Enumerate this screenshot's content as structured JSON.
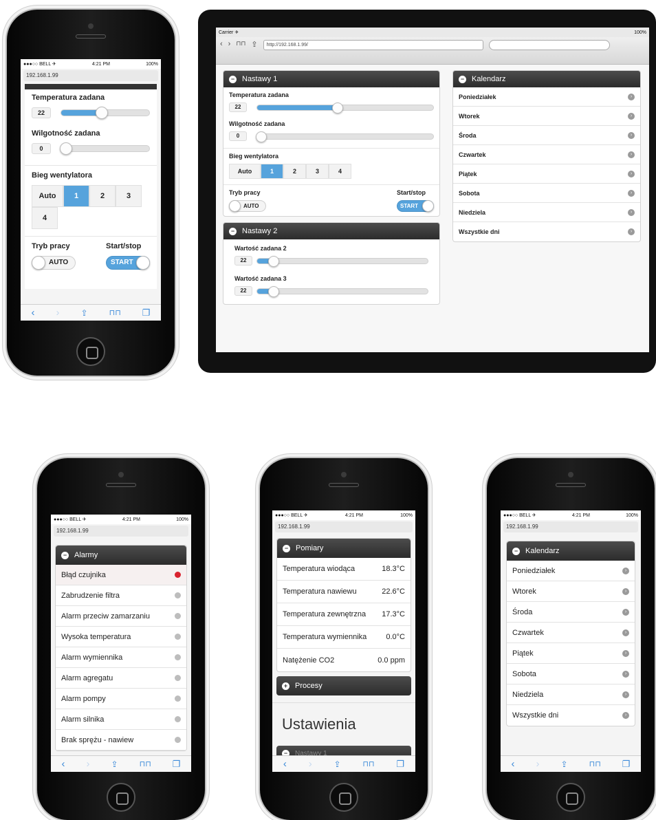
{
  "status": {
    "carrier": "●●●○○ BELL ✈",
    "time": "4:21 PM",
    "battery": "100%"
  },
  "url": "192.168.1.99",
  "toolbar": {
    "back": "‹",
    "forward": "›",
    "share": "⇪",
    "bookmarks": "⊓⊓",
    "tabs": "❐"
  },
  "nastawy1": {
    "title": "Nastawy 1",
    "temp_label": "Temperatura zadana",
    "temp_value": "22",
    "temp_level": 0.46,
    "hum_label": "Wilgotność zadana",
    "hum_value": "0",
    "hum_level": 0.0,
    "fan_label": "Bieg wentylatora",
    "fan_options": [
      "Auto",
      "1",
      "2",
      "3",
      "4"
    ],
    "fan_selected": "1",
    "mode_label": "Tryb pracy",
    "mode_value": "AUTO",
    "startstop_label": "Start/stop",
    "startstop_value": "START"
  },
  "nastawy2": {
    "title": "Nastawy 2",
    "v2_label": "Wartość zadana 2",
    "v2_value": "22",
    "v2_level": 0.1,
    "v3_label": "Wartość zadana 3",
    "v3_value": "22",
    "v3_level": 0.1
  },
  "kalendarz": {
    "title": "Kalendarz",
    "days": [
      "Poniedziałek",
      "Wtorek",
      "Środa",
      "Czwartek",
      "Piątek",
      "Sobota",
      "Niedziela",
      "Wszystkie dni"
    ]
  },
  "ipad": {
    "carrier": "Carrier ✈",
    "battery": "100%",
    "url": "http://192.168.1.99/"
  },
  "alarmy": {
    "title": "Alarmy",
    "items": [
      {
        "label": "Błąd czujnika",
        "active": true
      },
      {
        "label": "Zabrudzenie filtra",
        "active": false
      },
      {
        "label": "Alarm przeciw zamarzaniu",
        "active": false
      },
      {
        "label": "Wysoka temperatura",
        "active": false
      },
      {
        "label": "Alarm wymiennika",
        "active": false
      },
      {
        "label": "Alarm agregatu",
        "active": false
      },
      {
        "label": "Alarm pompy",
        "active": false
      },
      {
        "label": "Alarm silnika",
        "active": false
      },
      {
        "label": "Brak sprężu - nawiew",
        "active": false
      }
    ],
    "active_color": "#d9232f",
    "inactive_color": "#bdbdbd"
  },
  "pomiary": {
    "title": "Pomiary",
    "items": [
      {
        "label": "Temperatura wiodąca",
        "value": "18.3°C"
      },
      {
        "label": "Temperatura nawiewu",
        "value": "22.6°C"
      },
      {
        "label": "Temperatura zewnętrzna",
        "value": "17.3°C"
      },
      {
        "label": "Temperatura wymiennika",
        "value": "0.0°C"
      },
      {
        "label": "Natężenie CO2",
        "value": "0.0 ppm"
      }
    ],
    "procesy": "Procesy",
    "ustawienia": "Ustawienia",
    "nastawy_partial": "Nastawy 1"
  },
  "colors": {
    "accent": "#56a3dc",
    "header": "#333333"
  }
}
